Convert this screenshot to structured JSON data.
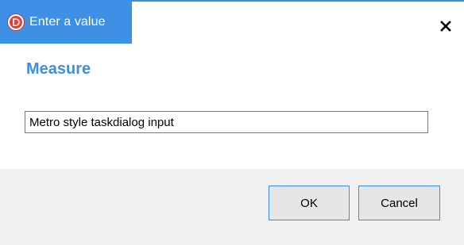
{
  "window": {
    "title": "Enter a value",
    "app_icon": "app-logo-icon",
    "close_icon": "close-icon"
  },
  "content": {
    "heading": "Measure",
    "input_value": "Metro style taskdialog input"
  },
  "buttons": {
    "ok_label": "OK",
    "cancel_label": "Cancel"
  },
  "colors": {
    "accent": "#3d90e3",
    "heading": "#3d8fe0",
    "footer_bg": "#f0f0f0",
    "icon_red": "#e0423a"
  }
}
